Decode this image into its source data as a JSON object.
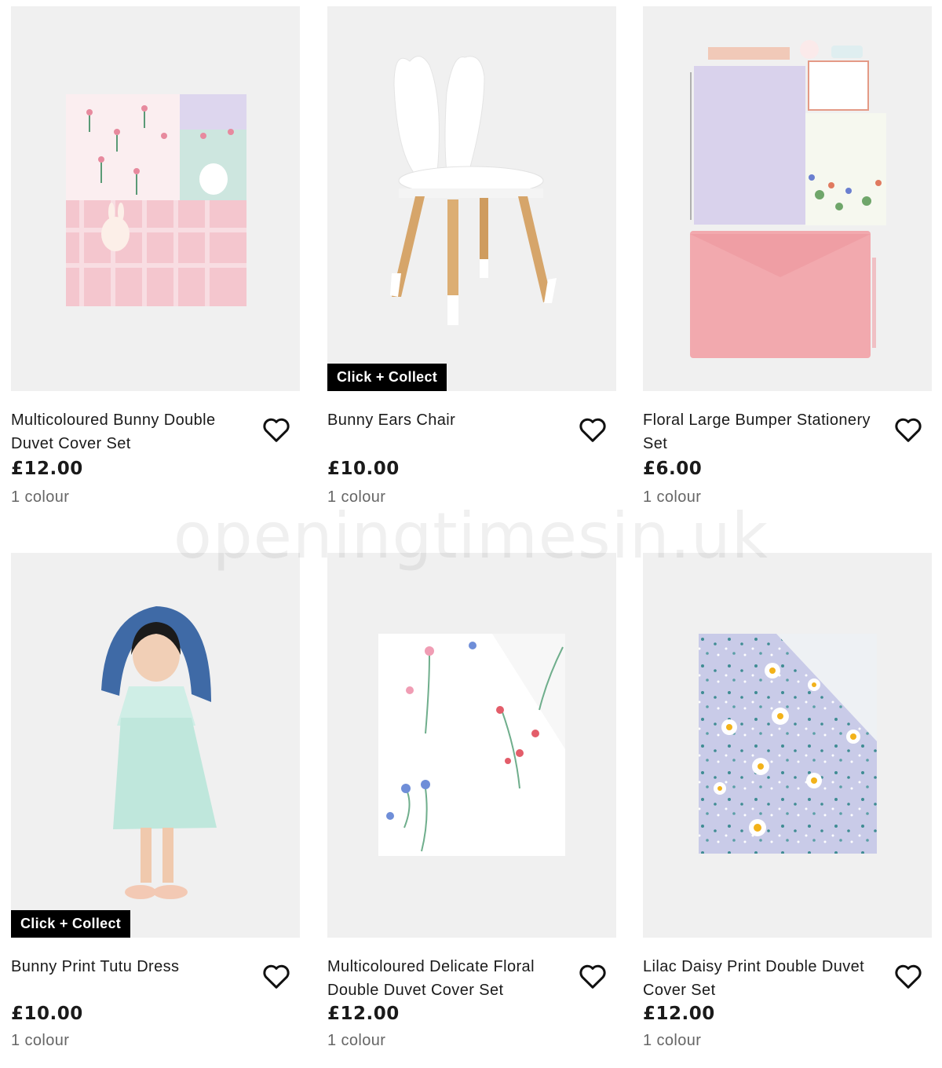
{
  "watermark": "openingtimesin.uk",
  "products": [
    {
      "title": "Multicoloured Bunny Double Duvet Cover Set",
      "price": "£12.00",
      "colours": "1 colour",
      "badge": "",
      "icon": "heart-icon"
    },
    {
      "title": "Bunny Ears Chair",
      "price": "£10.00",
      "colours": "1 colour",
      "badge": "Click + Collect",
      "icon": "heart-icon"
    },
    {
      "title": "Floral Large Bumper Stationery Set",
      "price": "£6.00",
      "colours": "1 colour",
      "badge": "",
      "icon": "heart-icon"
    },
    {
      "title": "Bunny Print Tutu Dress",
      "price": "£10.00",
      "colours": "1 colour",
      "badge": "Click + Collect",
      "icon": "heart-icon"
    },
    {
      "title": "Multicoloured Delicate Floral Double Duvet Cover Set",
      "price": "£12.00",
      "colours": "1 colour",
      "badge": "",
      "icon": "heart-icon"
    },
    {
      "title": "Lilac Daisy Print Double Duvet Cover Set",
      "price": "£12.00",
      "colours": "1 colour",
      "badge": "",
      "icon": "heart-icon"
    }
  ],
  "colors": {
    "badge_bg": "#000000",
    "image_bg": "#f0f0f0",
    "muted_text": "#666666"
  }
}
